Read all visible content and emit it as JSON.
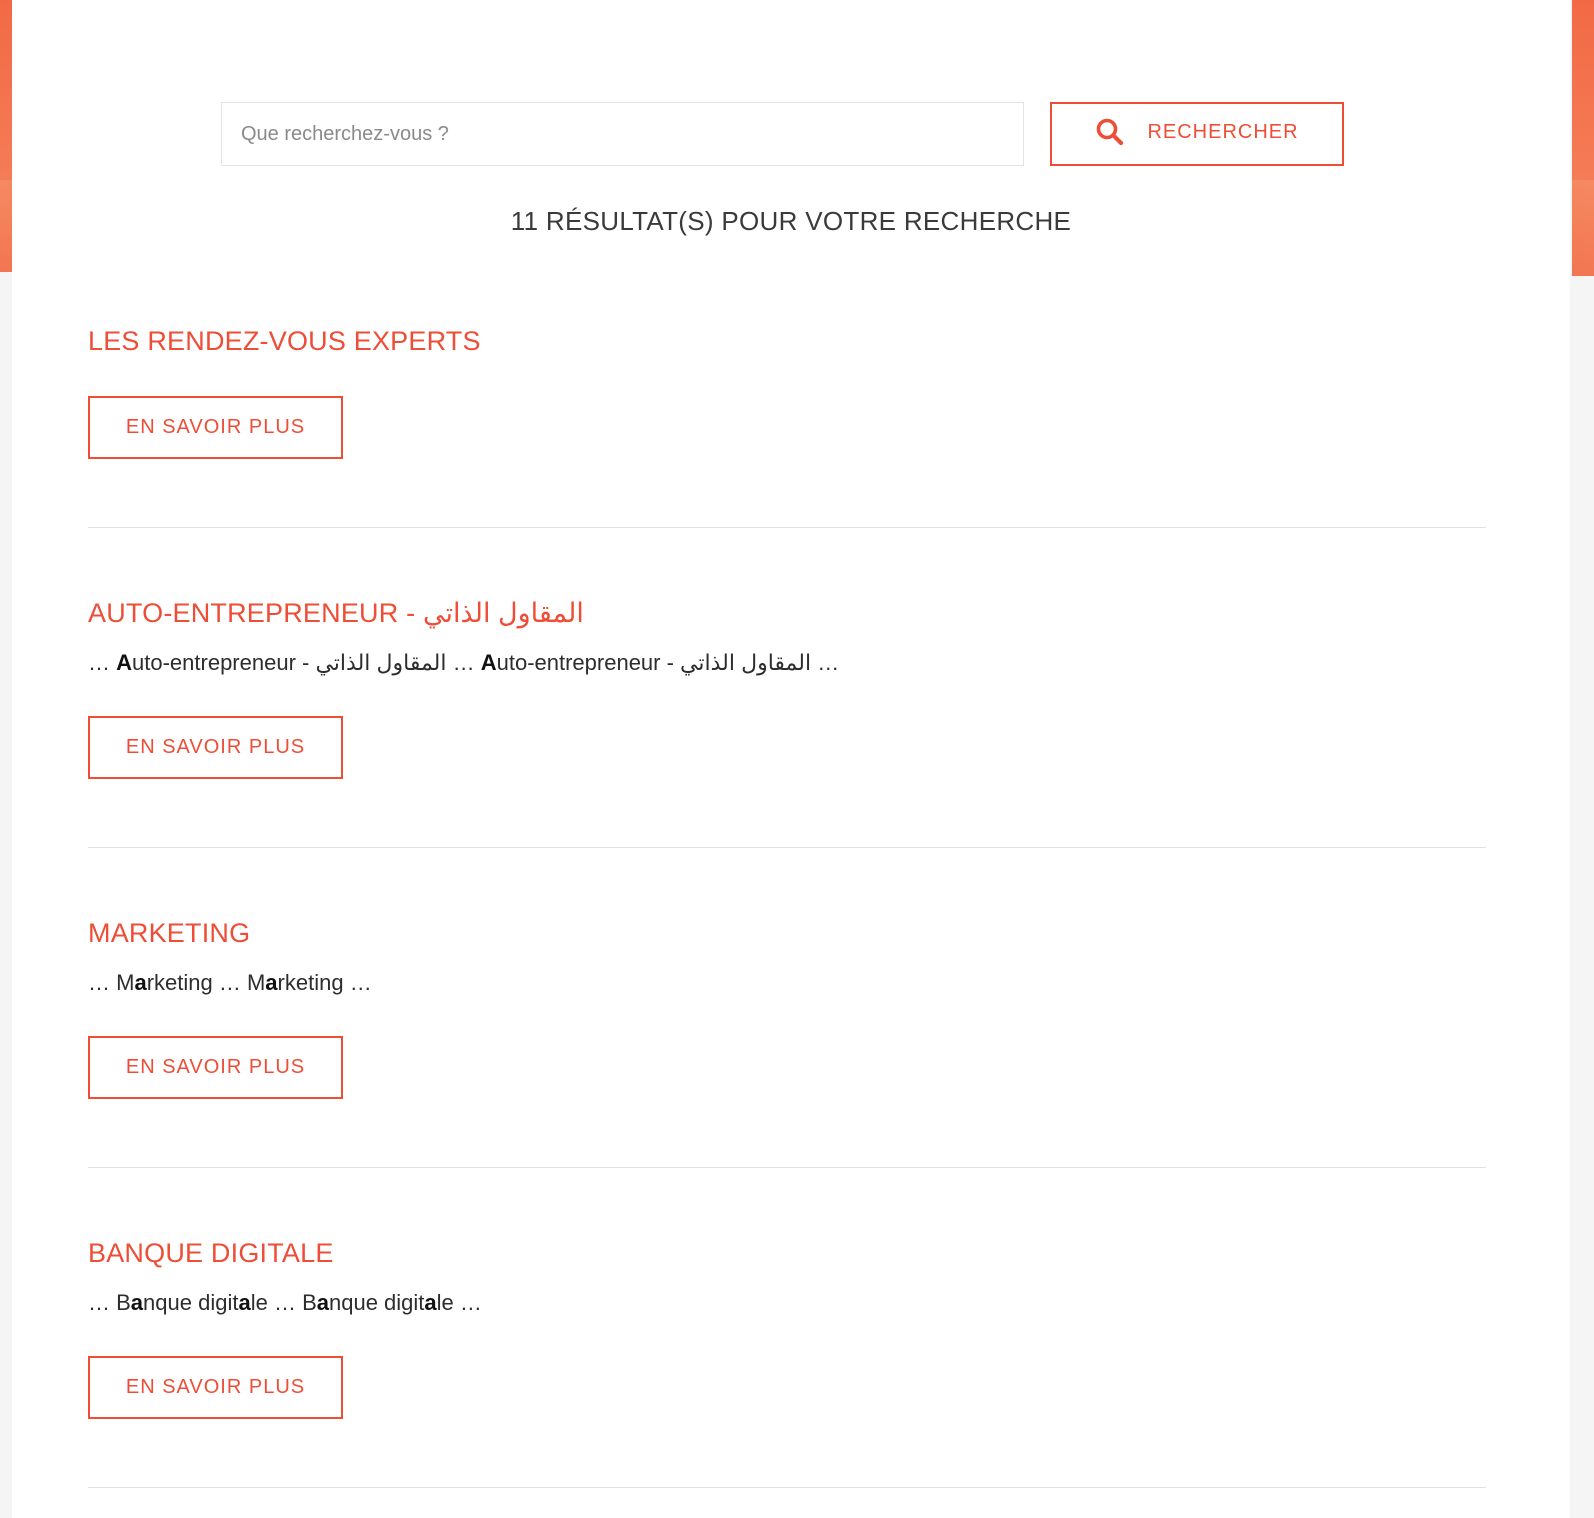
{
  "search": {
    "placeholder": "Que recherchez-vous ?",
    "value": "",
    "button_label": "RECHERCHER",
    "button_icon": "search-icon"
  },
  "results_header": "11 RÉSULTAT(S) POUR VOTRE RECHERCHE",
  "colors": {
    "accent": "#ee4d36",
    "decoration": "#f26a45",
    "text": "#3a3a3a",
    "divider": "#e2e2e2"
  },
  "results": [
    {
      "title": "LES RENDEZ-VOUS EXPERTS",
      "snippet": [],
      "button_label": "EN SAVOIR PLUS"
    },
    {
      "title": "AUTO-ENTREPRENEUR - المقاول الذاتي",
      "snippet": [
        {
          "text": "… "
        },
        {
          "text": "A",
          "bold": true
        },
        {
          "text": "uto-entrepreneur - المقاول الذاتي … "
        },
        {
          "text": "A",
          "bold": true
        },
        {
          "text": "uto-entrepreneur - المقاول الذاتي …"
        }
      ],
      "button_label": "EN SAVOIR PLUS"
    },
    {
      "title": "MARKETING",
      "snippet": [
        {
          "text": "… M"
        },
        {
          "text": "a",
          "bold": true
        },
        {
          "text": "rketing … M"
        },
        {
          "text": "a",
          "bold": true
        },
        {
          "text": "rketing …"
        }
      ],
      "button_label": "EN SAVOIR PLUS"
    },
    {
      "title": "BANQUE DIGITALE",
      "snippet": [
        {
          "text": "… B"
        },
        {
          "text": "a",
          "bold": true
        },
        {
          "text": "nque digit"
        },
        {
          "text": "a",
          "bold": true
        },
        {
          "text": "le … B"
        },
        {
          "text": "a",
          "bold": true
        },
        {
          "text": "nque digit"
        },
        {
          "text": "a",
          "bold": true
        },
        {
          "text": "le …"
        }
      ],
      "button_label": "EN SAVOIR PLUS"
    }
  ]
}
